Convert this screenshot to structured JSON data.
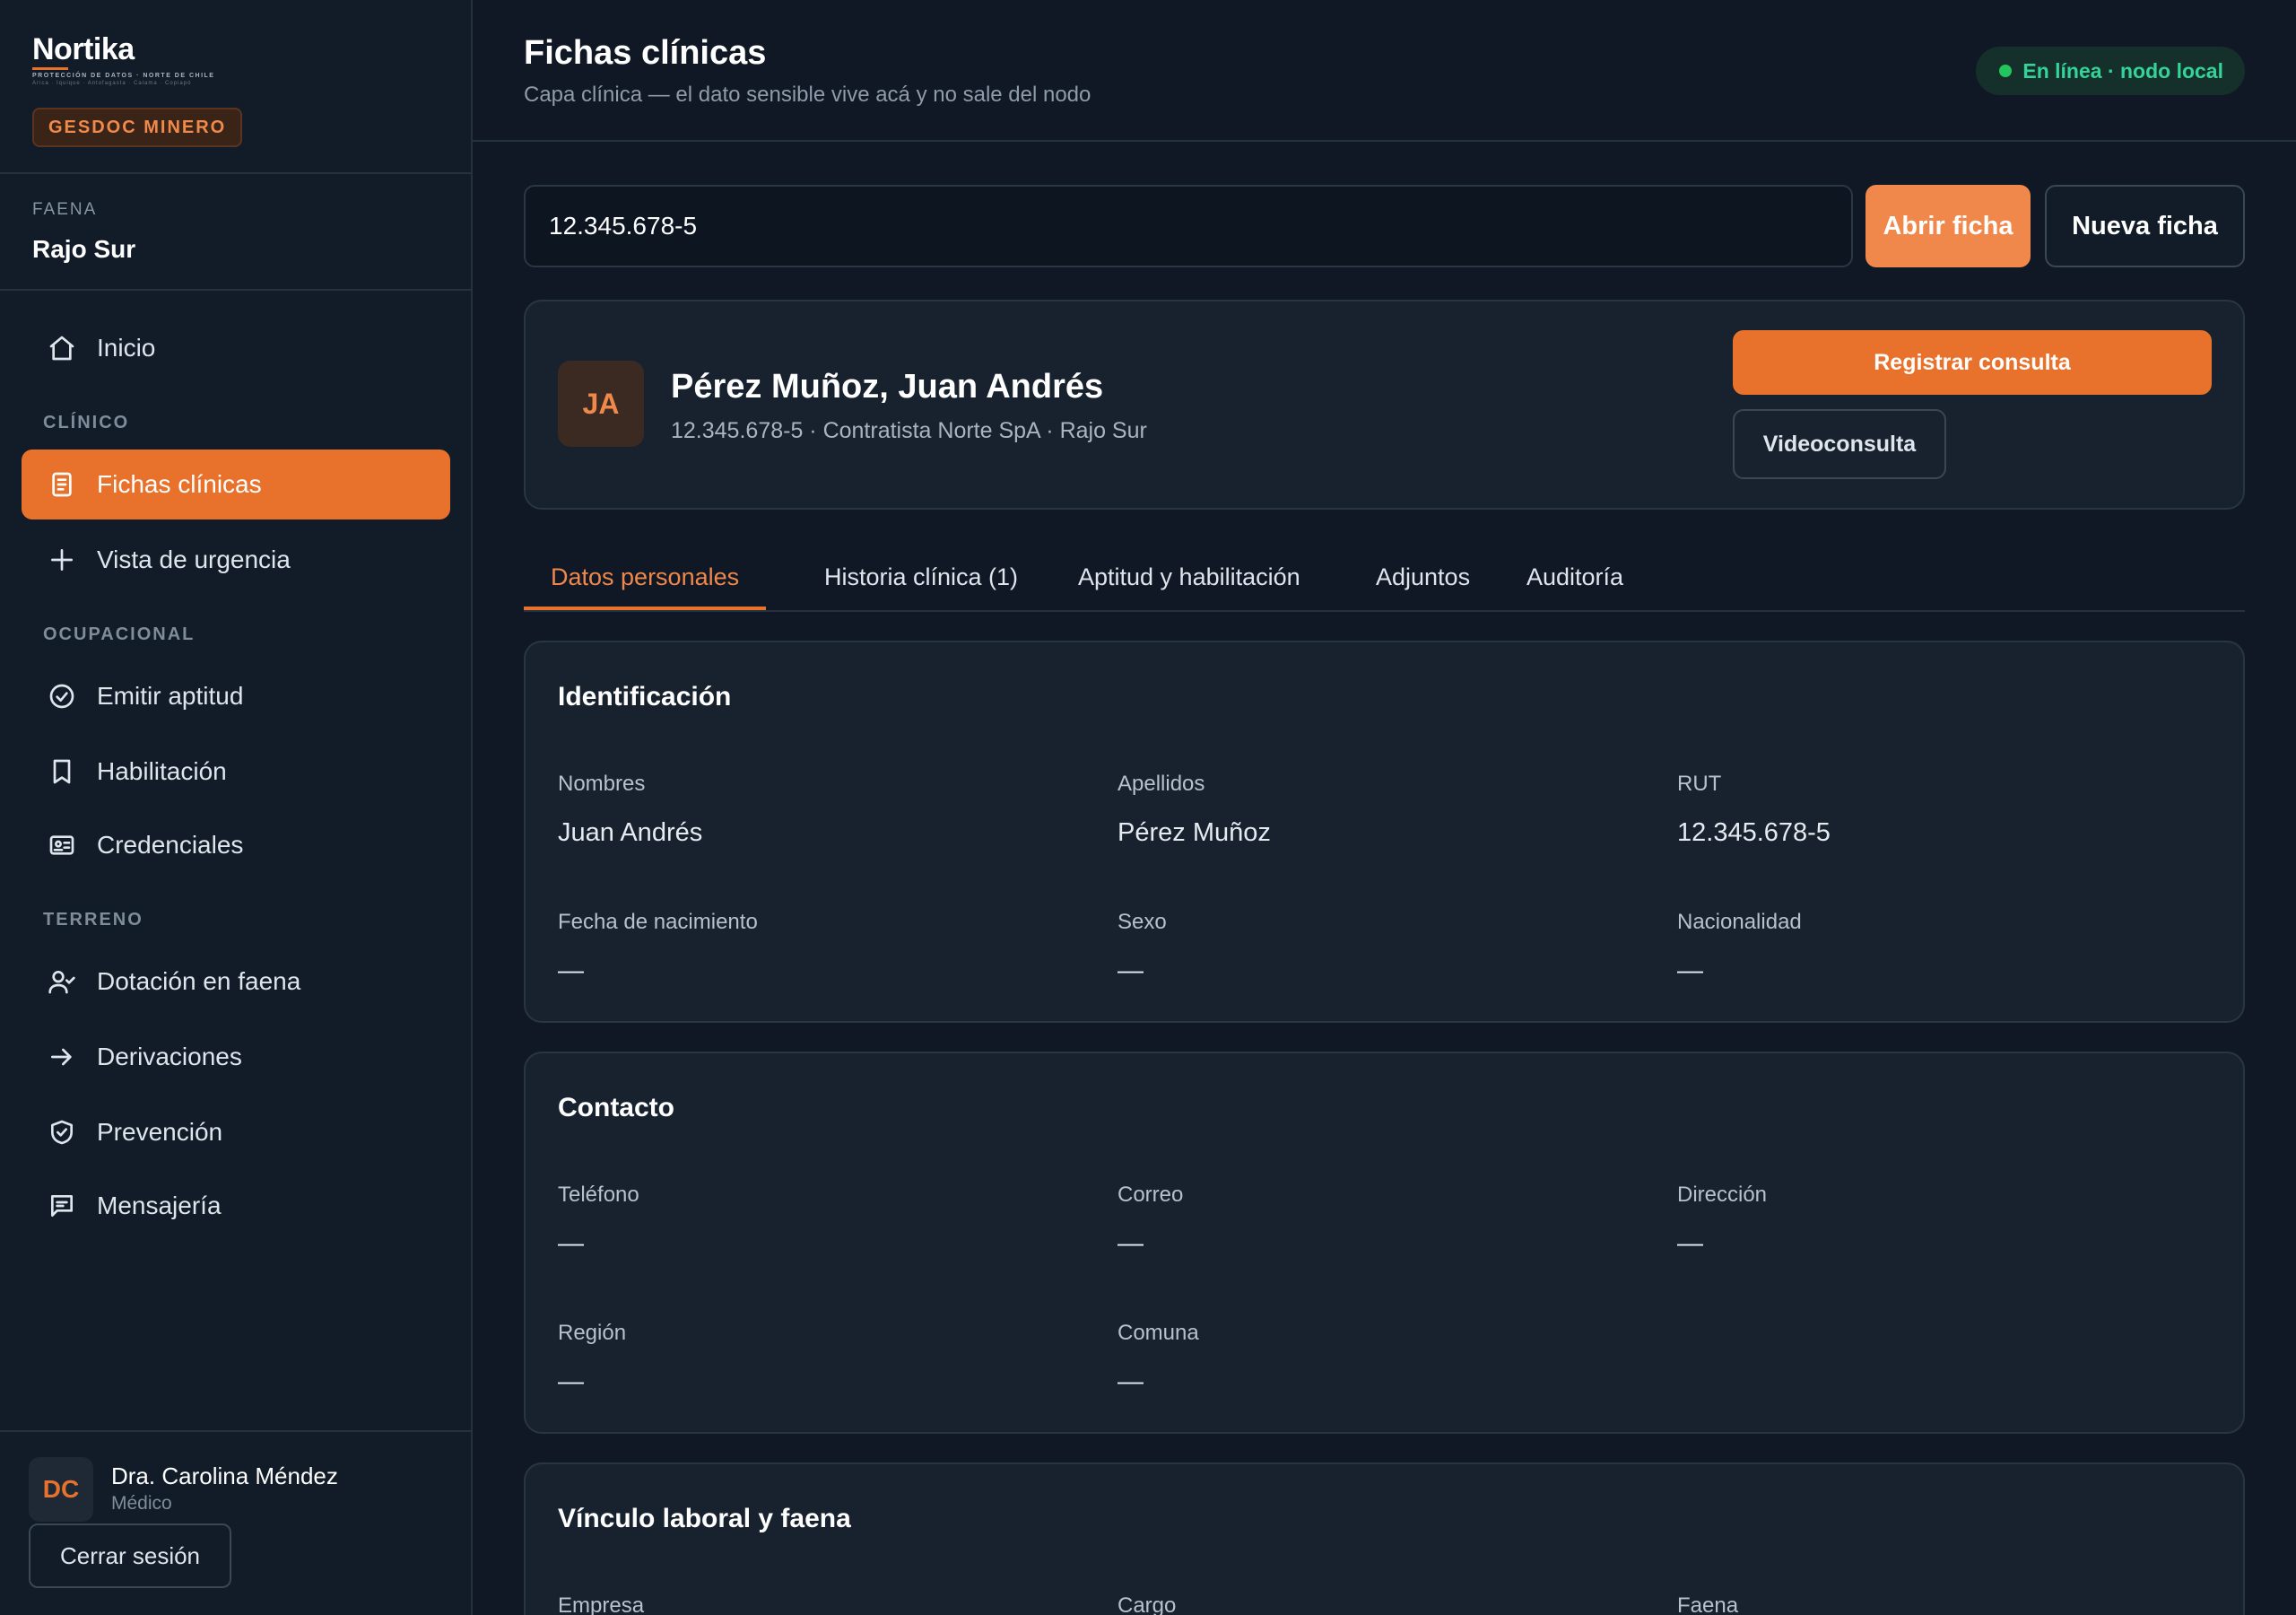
{
  "brand": {
    "name": "Nortika",
    "tagline": "PROTECCIÓN DE DATOS · NORTE DE CHILE",
    "cities": "Arica · Iquique · Antofagasta · Calama · Copiapó",
    "product": "GESDOC MINERO"
  },
  "faena": {
    "label": "FAENA",
    "value": "Rajo Sur"
  },
  "nav": {
    "inicio": "Inicio",
    "sections": {
      "clinico": "CLÍNICO",
      "ocupacional": "OCUPACIONAL",
      "terreno": "TERRENO"
    },
    "fichas": "Fichas clínicas",
    "urgencia": "Vista de urgencia",
    "aptitud": "Emitir aptitud",
    "habilitacion": "Habilitación",
    "credenciales": "Credenciales",
    "dotacion": "Dotación en faena",
    "derivaciones": "Derivaciones",
    "prevencion": "Prevención",
    "mensajeria": "Mensajería"
  },
  "user": {
    "initials": "DC",
    "name": "Dra. Carolina Méndez",
    "role": "Médico",
    "logout": "Cerrar sesión"
  },
  "header": {
    "title": "Fichas clínicas",
    "subtitle": "Capa clínica — el dato sensible vive acá y no sale del nodo",
    "status": "En línea · nodo local"
  },
  "search": {
    "value": "12.345.678-5",
    "open": "Abrir ficha",
    "new": "Nueva ficha"
  },
  "patient": {
    "initials": "JA",
    "name": "Pérez Muñoz, Juan Andrés",
    "meta": "12.345.678-5 · Contratista Norte SpA · Rajo Sur",
    "register": "Registrar consulta",
    "video": "Videoconsulta"
  },
  "tabs": [
    "Datos personales",
    "Historia clínica (1)",
    "Aptitud y habilitación",
    "Adjuntos",
    "Auditoría"
  ],
  "identificacion": {
    "title": "Identificación",
    "fields": [
      {
        "label": "Nombres",
        "value": "Juan Andrés"
      },
      {
        "label": "Apellidos",
        "value": "Pérez Muñoz"
      },
      {
        "label": "RUT",
        "value": "12.345.678-5"
      },
      {
        "label": "Fecha de nacimiento",
        "value": "—"
      },
      {
        "label": "Sexo",
        "value": "—"
      },
      {
        "label": "Nacionalidad",
        "value": "—"
      }
    ]
  },
  "contacto": {
    "title": "Contacto",
    "fields": [
      {
        "label": "Teléfono",
        "value": "—"
      },
      {
        "label": "Correo",
        "value": "—"
      },
      {
        "label": "Dirección",
        "value": "—"
      },
      {
        "label": "Región",
        "value": "—"
      },
      {
        "label": "Comuna",
        "value": "—"
      }
    ]
  },
  "vinculo": {
    "title": "Vínculo laboral y faena",
    "fields": [
      {
        "label": "Empresa"
      },
      {
        "label": "Cargo"
      },
      {
        "label": "Faena"
      }
    ]
  },
  "colors": {
    "accent": "#e8722c",
    "status": "#34d399",
    "background": "#0f1824"
  }
}
